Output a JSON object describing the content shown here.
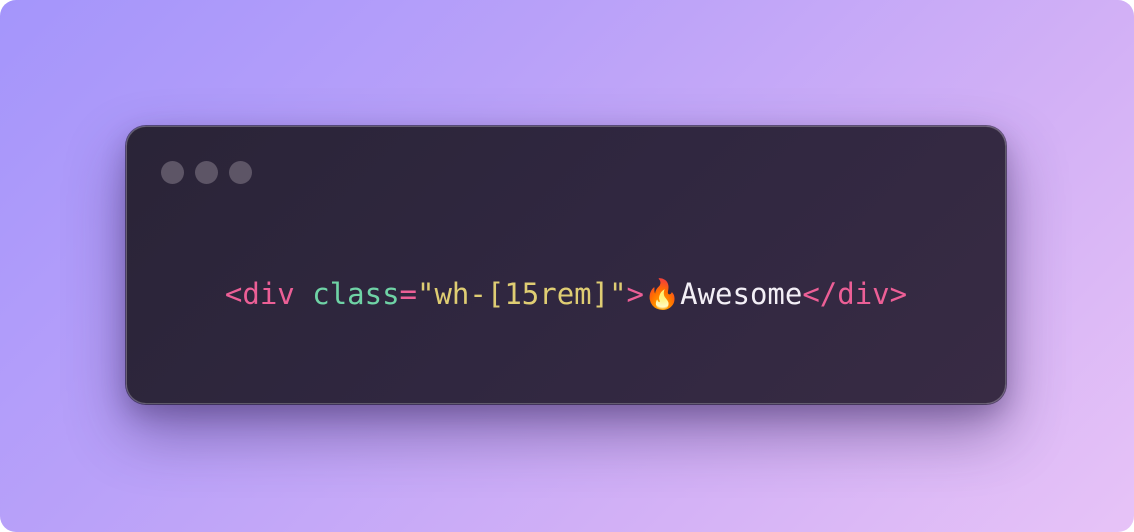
{
  "window": {
    "controls": [
      "window-dot",
      "window-dot",
      "window-dot"
    ]
  },
  "code": {
    "open_bracket": "<",
    "tag": "div",
    "space": " ",
    "attr": "class",
    "equals": "=",
    "value": "\"wh-[15rem]\"",
    "close_bracket": ">",
    "emoji": "🔥",
    "text": "Awesome",
    "closing_tag": "</div>"
  },
  "colors": {
    "tag": "#ec5f96",
    "attribute": "#6fd3a6",
    "string": "#dfcd73",
    "text": "#f3eff6",
    "window_bg": "#2e2640",
    "dot": "#5d5566"
  }
}
